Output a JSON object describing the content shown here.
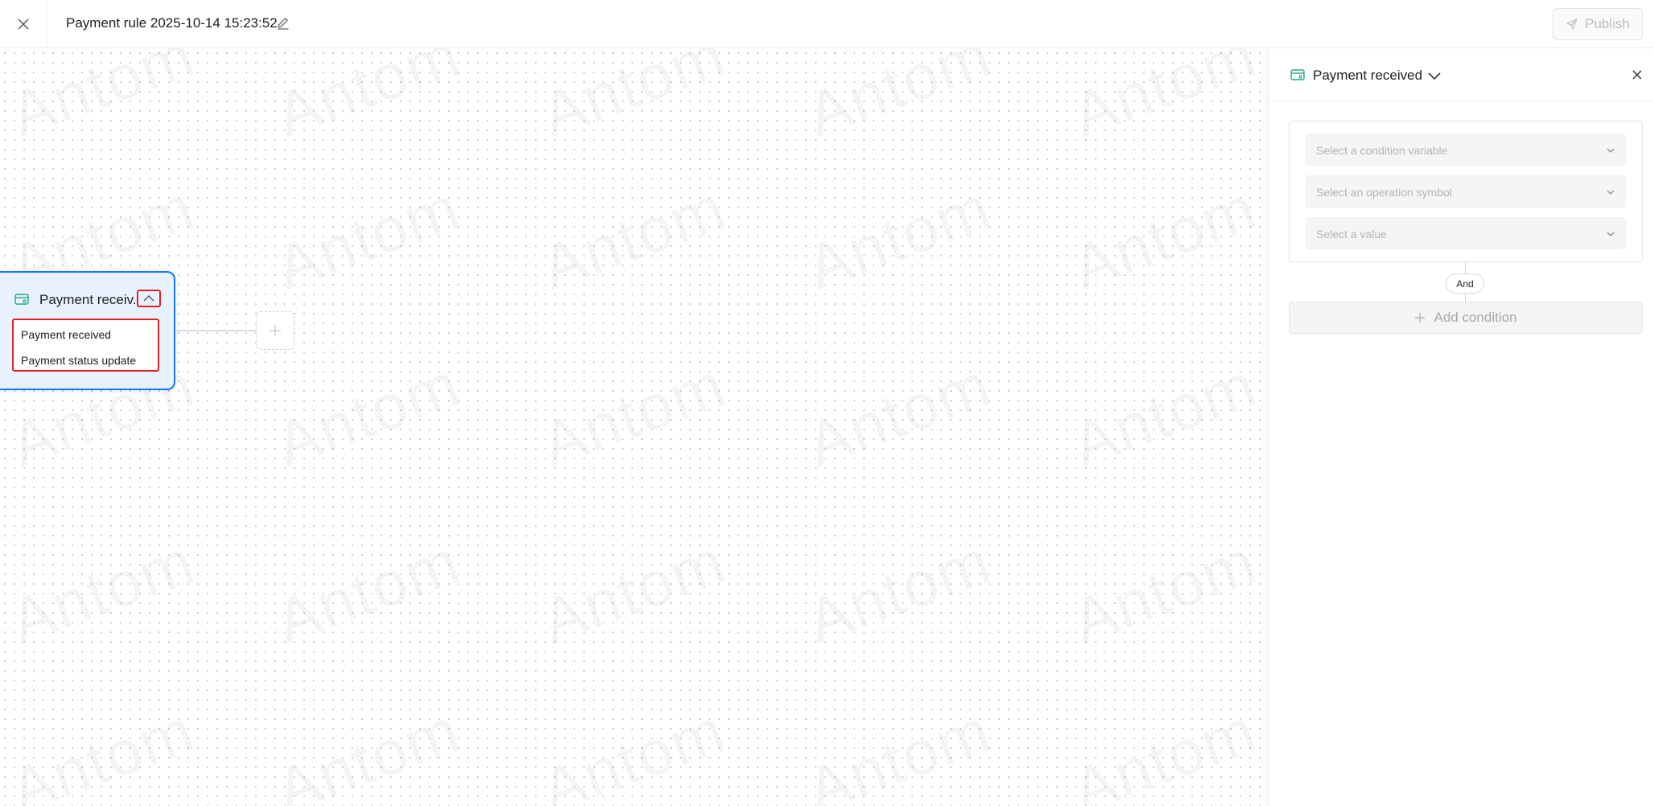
{
  "header": {
    "title": "Payment rule 2025-10-14 15:23:52",
    "publish_label": "Publish",
    "icons": {
      "close": "close-icon",
      "edit": "pencil-icon",
      "publish": "send-icon"
    }
  },
  "canvas": {
    "watermark_text": "Antom",
    "node": {
      "title": "Payment receiv...",
      "icon": "payment-card-icon",
      "toggle_icon": "chevron-up-icon",
      "options": [
        "Payment received",
        "Payment status update"
      ]
    },
    "add_node_icon": "plus-icon"
  },
  "panel": {
    "title": "Payment received",
    "icon": "payment-card-icon",
    "condition": {
      "variable_placeholder": "Select a condition variable",
      "operator_placeholder": "Select an operation symbol",
      "value_placeholder": "Select a value"
    },
    "and_label": "And",
    "add_condition_label": "Add condition"
  },
  "colors": {
    "accent": "#1677ff",
    "node_bg": "#e8f2fe",
    "highlight": "#e02424",
    "icon_teal": "#1ba98a"
  }
}
